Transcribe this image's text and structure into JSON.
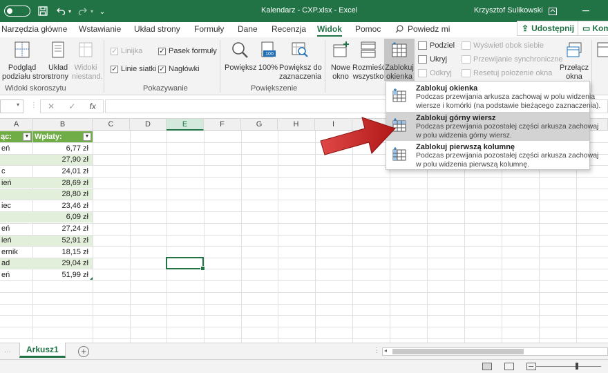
{
  "titlebar": {
    "autosave_state": "off",
    "window_title": "Kalendarz - CXP.xlsx  -  Excel",
    "user_name": "Krzysztof Sulikowski"
  },
  "tabs": [
    "Narzędzia główne",
    "Wstawianie",
    "Układ strony",
    "Formuły",
    "Dane",
    "Recenzja",
    "Widok",
    "Pomoc"
  ],
  "active_tab": "Widok",
  "tell_me": "Powiedz mi",
  "share_label": "Udostępnij",
  "comments_label": "Kom",
  "ribbon": {
    "views": {
      "page_break": "Podgląd\npodziału stron",
      "page_layout": "Układ\nstrony",
      "custom_views": "Widoki\nniestand.",
      "group_label": "Widoki skoroszytu"
    },
    "show": {
      "ruler": "Linijka",
      "formula_bar": "Pasek formuły",
      "gridlines": "Linie siatki",
      "headings": "Nagłówki",
      "ruler_checked": true,
      "formula_bar_checked": true,
      "gridlines_checked": true,
      "headings_checked": true,
      "group_label": "Pokazywanie"
    },
    "zoom": {
      "zoom": "Powiększ",
      "zoom_100": "100%",
      "zoom_selection": "Powiększ do\nzaznaczenia",
      "group_label": "Powiększenie"
    },
    "window": {
      "new_window": "Nowe\nokno",
      "arrange_all": "Rozmieść\nwszystko",
      "freeze_panes": "Zablokuj\nokienka",
      "split": "Podziel",
      "hide": "Ukryj",
      "unhide": "Odkryj",
      "side_by_side": "Wyświetl obok siebie",
      "sync_scroll": "Przewijanie synchroniczne",
      "reset_position": "Resetuj położenie okna",
      "switch_windows": "Przełącz\nokna"
    }
  },
  "formula_bar": {
    "fx": "fx"
  },
  "columns": [
    "A",
    "B",
    "C",
    "D",
    "E",
    "F",
    "G",
    "H",
    "I"
  ],
  "selected_column": "E",
  "table": {
    "header_a": "ąc:",
    "header_b": "Wpłaty:",
    "rows": [
      {
        "a": "eń",
        "b": "6,77 zł"
      },
      {
        "a": "",
        "b": "27,90 zł"
      },
      {
        "a": "c",
        "b": "24,01 zł"
      },
      {
        "a": "ień",
        "b": "28,69 zł"
      },
      {
        "a": "",
        "b": "28,80 zł"
      },
      {
        "a": "iec",
        "b": "23,46 zł"
      },
      {
        "a": "",
        "b": "6,09 zł"
      },
      {
        "a": "eń",
        "b": "27,24 zł"
      },
      {
        "a": "ień",
        "b": "52,91 zł"
      },
      {
        "a": "ernik",
        "b": "18,15 zł"
      },
      {
        "a": "ad",
        "b": "29,04 zł"
      },
      {
        "a": "eń",
        "b": "51,99 zł"
      }
    ]
  },
  "sheet_tab": "Arkusz1",
  "dropdown": {
    "items": [
      {
        "title": "Zablokuj okienka",
        "desc1": "Podczas przewijania arkusza zachowaj w polu widzenia",
        "desc2": "wiersze i komórki (na podstawie bieżącego zaznaczenia)."
      },
      {
        "title": "Zablokuj górny wiersz",
        "desc1": "Podczas przewijania pozostałej części arkusza zachowaj",
        "desc2": "w polu widzenia górny wiersz."
      },
      {
        "title": "Zablokuj pierwszą kolumnę",
        "desc1": "Podczas przewijania pozostałej części arkusza zachowaj",
        "desc2": "w polu widzenia pierwszą kolumnę."
      }
    ],
    "hovered_index": 1
  },
  "colors": {
    "excel_green": "#217346",
    "table_header": "#70ad47",
    "table_band": "#e2efda",
    "arrow_red": "#c81e1e"
  }
}
